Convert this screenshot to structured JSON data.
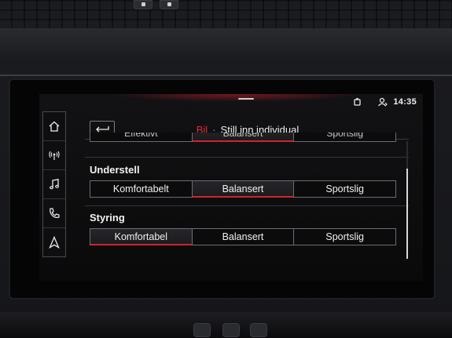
{
  "status_bar": {
    "time": "14:35",
    "icons": [
      "wireless-connection-icon",
      "user-profile-icon"
    ]
  },
  "nav_rail": [
    {
      "name": "home",
      "icon": "home-icon"
    },
    {
      "name": "radio",
      "icon": "radio-icon"
    },
    {
      "name": "media",
      "icon": "music-note-icon"
    },
    {
      "name": "phone",
      "icon": "phone-icon"
    },
    {
      "name": "navigation",
      "icon": "navigation-arrow-icon"
    }
  ],
  "header": {
    "back_icon": "back-arrow-icon",
    "crumb_parent": "Bil",
    "separator": "·",
    "crumb_current": "Still inn individual"
  },
  "clipped_row": {
    "options": [
      "Effektivt",
      "Balansert",
      "Sportslig"
    ],
    "selected_index": 1
  },
  "sections": [
    {
      "title": "Understell",
      "options": [
        "Komfortabelt",
        "Balansert",
        "Sportslig"
      ],
      "selected_index": 1
    },
    {
      "title": "Styring",
      "options": [
        "Komfortabel",
        "Balansert",
        "Sportslig"
      ],
      "selected_index": 0
    }
  ],
  "colors": {
    "accent": "#e8283a",
    "selected_underline": "#d0232f",
    "text": "#f0f0f0"
  }
}
